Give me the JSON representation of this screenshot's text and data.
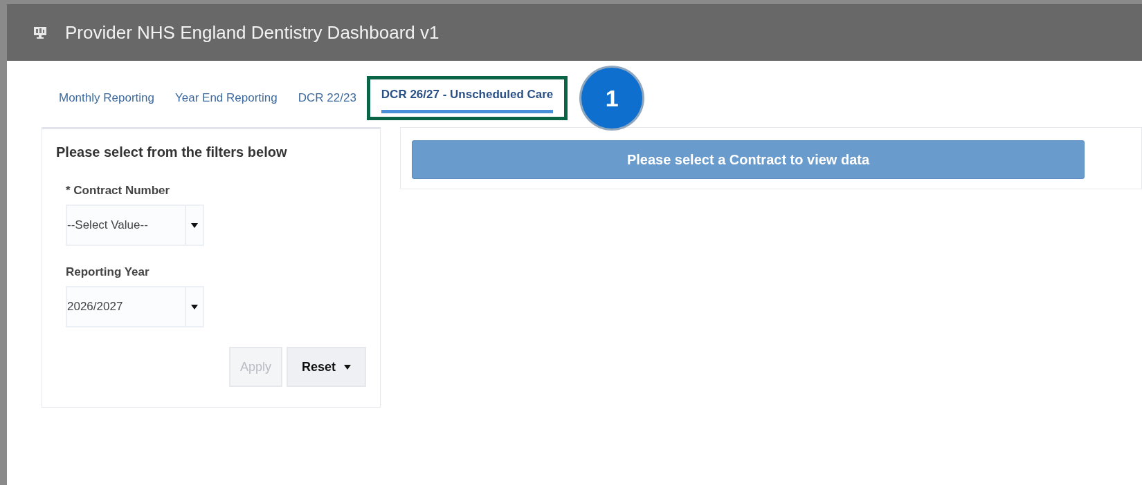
{
  "window": {
    "title": "Provider NHS England Dentistry Dashboard v1"
  },
  "tabs": [
    {
      "label": "Monthly Reporting",
      "selected": false,
      "highlighted": false
    },
    {
      "label": "Year End Reporting",
      "selected": false,
      "highlighted": false
    },
    {
      "label": "DCR 22/23",
      "selected": false,
      "highlighted": false
    },
    {
      "label": "DCR 26/27 - Unscheduled Care",
      "selected": true,
      "highlighted": true
    }
  ],
  "callout": {
    "label": "1"
  },
  "filters": {
    "heading": "Please select from the filters below",
    "fields": [
      {
        "label": "* Contract Number",
        "value": "--Select Value--"
      },
      {
        "label": "Reporting Year",
        "value": "2026/2027"
      }
    ],
    "buttons": [
      {
        "label": "Apply",
        "disabled": true,
        "menu": false
      },
      {
        "label": "Reset",
        "disabled": false,
        "menu": true
      }
    ]
  },
  "message": "Please select a Contract to view data"
}
